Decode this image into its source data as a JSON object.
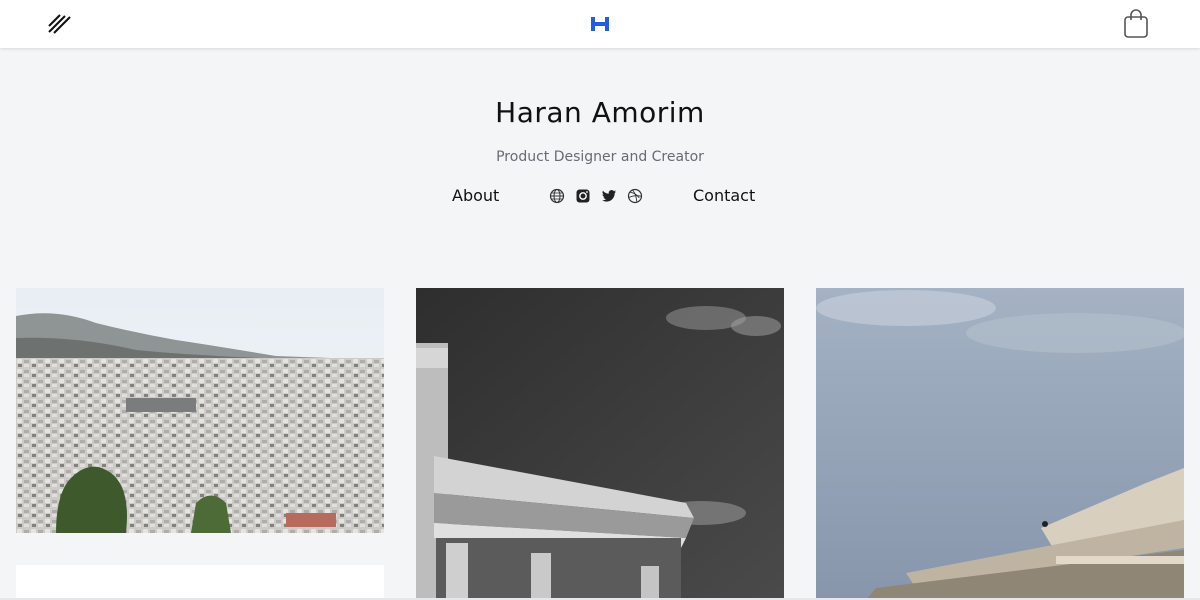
{
  "header": {
    "menu_icon": "menu-slashes-icon",
    "logo_letter": "H",
    "logo_color": "#1f5ee8",
    "cart_icon": "shopping-bag-icon"
  },
  "hero": {
    "name": "Haran Amorim",
    "subtitle": "Product Designer and Creator"
  },
  "nav": {
    "about": "About",
    "contact": "Contact",
    "social_icons": [
      "globe-icon",
      "instagram-icon",
      "twitter-icon",
      "dribbble-icon"
    ]
  },
  "gallery": {
    "tiles": [
      {
        "icon": "city-photo"
      },
      {
        "icon": "ancient-temple-bw-photo"
      },
      {
        "icon": "ancient-temple-sky-photo"
      }
    ]
  },
  "colors": {
    "background": "#f4f5f7",
    "header_bg": "#ffffff",
    "subtitle": "#666b73"
  }
}
